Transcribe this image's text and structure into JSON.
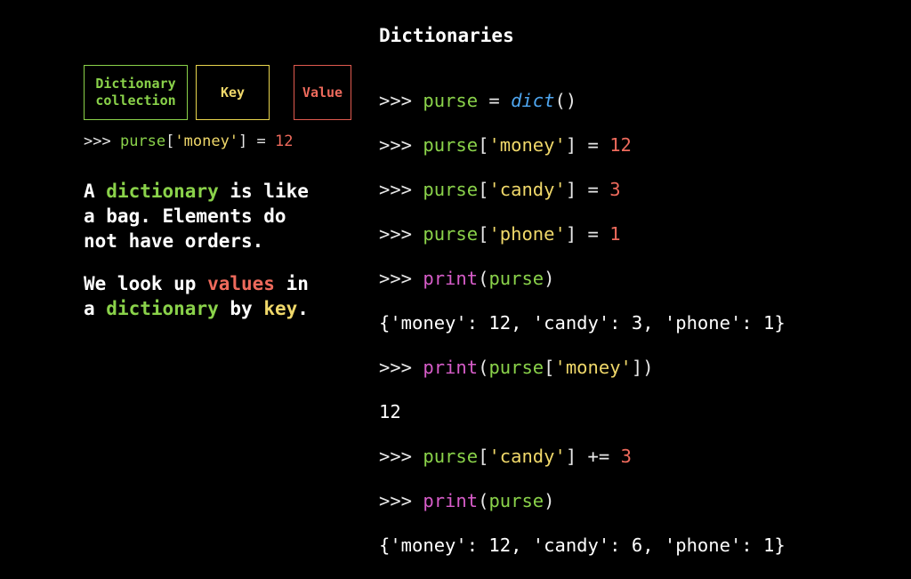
{
  "title": "Dictionaries",
  "legend": {
    "dict_line1": "Dictionary",
    "dict_line2": "collection",
    "key": "Key",
    "value": "Value"
  },
  "example": {
    "prompt": ">>> ",
    "var": "purse",
    "open": "[",
    "key": "'money'",
    "close": "]",
    "assign": " = ",
    "value": "12"
  },
  "paragraph1": {
    "a": "A ",
    "dictionary": "dictionary",
    "rest1": " is like",
    "line2": "a bag. Elements do",
    "line3": "not have orders."
  },
  "paragraph2": {
    "line1_a": "We look up ",
    "values": "values",
    "line1_b": " in",
    "line2_a": "a ",
    "dictionary": "dictionary",
    "line2_b": " by ",
    "key": "key",
    "line2_c": "."
  },
  "code": {
    "prompt": ">>> ",
    "l1": {
      "var": "purse",
      "op": " = ",
      "fn": "dict",
      "parens": "()"
    },
    "l2": {
      "var": "purse",
      "open": "[",
      "key": "'money'",
      "close": "]",
      "op": " = ",
      "val": "12"
    },
    "l3": {
      "var": "purse",
      "open": "[",
      "key": "'candy'",
      "close": "]",
      "op": " = ",
      "val": "3"
    },
    "l4": {
      "var": "purse",
      "open": "[",
      "key": "'phone'",
      "close": "]",
      "op": " = ",
      "val": "1"
    },
    "l5": {
      "fn": "print",
      "open": "(",
      "arg": "purse",
      "close": ")"
    },
    "l6": "{'money': 12, 'candy': 3, 'phone': 1}",
    "l7": {
      "fn": "print",
      "open": "(",
      "var": "purse",
      "bopen": "[",
      "key": "'money'",
      "bclose": "])"
    },
    "l8": "12",
    "l9": {
      "var": "purse",
      "open": "[",
      "key": "'candy'",
      "close": "]",
      "op": " += ",
      "val": "3"
    },
    "l10": {
      "fn": "print",
      "open": "(",
      "arg": "purse",
      "close": ")"
    },
    "l11": "{'money': 12, 'candy': 6, 'phone': 1}"
  },
  "colors": {
    "dictionary_green": "#8ad24a",
    "key_yellow": "#f0d86a",
    "value_red": "#ee6a5c",
    "function_magenta": "#d65cc8",
    "builtin_blue": "#4ea6f0",
    "background": "#000000"
  }
}
